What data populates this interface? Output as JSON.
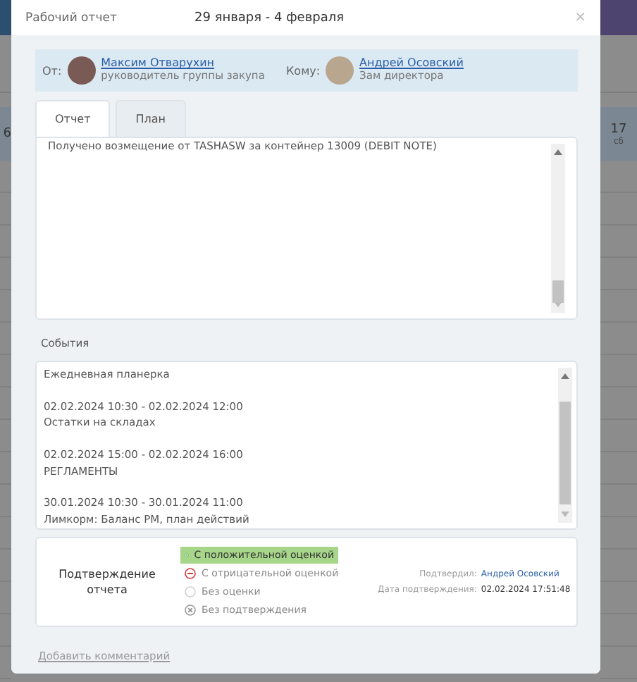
{
  "background": {
    "left_day": "6",
    "right_day": "17",
    "right_weekday": "сб"
  },
  "window": {
    "title": "Рабочий отчет",
    "period": "29 января - 4 февраля",
    "close": "×"
  },
  "people": {
    "from_label": "От:",
    "from_name": "Максим Отварухин",
    "from_role": "руководитель группы закупа",
    "to_label": "Кому:",
    "to_name": "Андрей Осовский",
    "to_role": "Зам директора"
  },
  "tabs": [
    {
      "label": "Отчет",
      "selected": true
    },
    {
      "label": "План",
      "selected": false
    }
  ],
  "report_text": "Получено возмещение от TASHASW за контейнер 13009 (DEBIT NOTE)",
  "events": {
    "title": "События",
    "items": [
      {
        "name": "Ежедневная планерка"
      },
      {
        "time": "02.02.2024 10:30 - 02.02.2024 12:00",
        "name": "Остатки на складах"
      },
      {
        "time": "02.02.2024 15:00 - 02.02.2024 16:00",
        "name": "РЕГЛАМЕНТЫ"
      },
      {
        "time": "30.01.2024 10:30 - 30.01.2024 11:00",
        "name": "Лимкорм: Баланс РМ, план действий"
      }
    ]
  },
  "confirmation": {
    "title": "Подтверждение отчета",
    "options": [
      {
        "kind": "positive",
        "label": "С положительной оценкой",
        "selected": true
      },
      {
        "kind": "negative",
        "label": "С отрицательной оценкой",
        "selected": false
      },
      {
        "kind": "neutral",
        "label": "Без оценки",
        "selected": false
      },
      {
        "kind": "unconfirmed",
        "label": "Без подтверждения",
        "selected": false
      }
    ],
    "confirmed_by_label": "Подтвердил:",
    "confirmed_by": "Андрей Осовский",
    "date_label": "Дата подтверждения:",
    "date": "02.02.2024 17:51:48"
  },
  "add_comment": "Добавить комментарий"
}
